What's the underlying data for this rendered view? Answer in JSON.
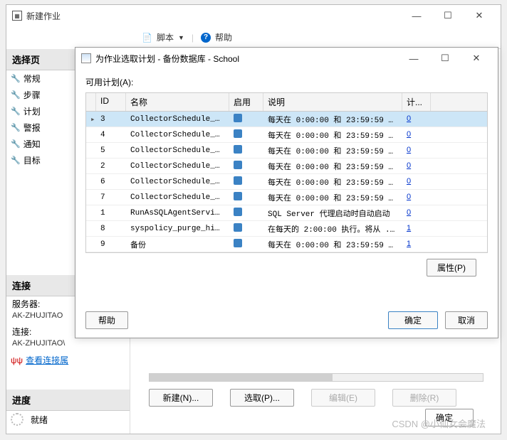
{
  "window": {
    "title": "新建作业",
    "min": "—",
    "max": "☐",
    "close": "✕"
  },
  "toolbar": {
    "script": "脚本",
    "dropdown": "▼",
    "help": "帮助"
  },
  "sidebar": {
    "select_header": "选择页",
    "items": [
      {
        "label": "常规"
      },
      {
        "label": "步骤"
      },
      {
        "label": "计划"
      },
      {
        "label": "警报"
      },
      {
        "label": "通知"
      },
      {
        "label": "目标"
      }
    ],
    "conn_header": "连接",
    "server_label": "服务器:",
    "server_val": "AK-ZHUJITAO",
    "conn_label": "连接:",
    "conn_val": "AK-ZHUJITAO\\",
    "view_conn": "查看连接属",
    "progress_header": "进度",
    "ready": "就绪"
  },
  "buttons": {
    "new": "新建(N)...",
    "pick": "选取(P)...",
    "edit": "编辑(E)",
    "delete": "删除(R)",
    "ok": "确定",
    "cancel": "取消",
    "help": "帮助",
    "props": "属性(P)"
  },
  "modal": {
    "title": "为作业选取计划 - 备份数据库 - School",
    "available": "可用计划(A):",
    "cols": {
      "id": "ID",
      "name": "名称",
      "enabled": "启用",
      "desc": "说明",
      "count": "计..."
    },
    "rows": [
      {
        "id": "3",
        "name": "CollectorSchedule_E...",
        "desc": "每天在 0:00:00 和 23:59:59 ...",
        "count": "0",
        "sel": true
      },
      {
        "id": "4",
        "name": "CollectorSchedule_E...",
        "desc": "每天在 0:00:00 和 23:59:59 ...",
        "count": "0"
      },
      {
        "id": "5",
        "name": "CollectorSchedule_E...",
        "desc": "每天在 0:00:00 和 23:59:59 ...",
        "count": "0"
      },
      {
        "id": "2",
        "name": "CollectorSchedule_E...",
        "desc": "每天在 0:00:00 和 23:59:59 ...",
        "count": "0"
      },
      {
        "id": "6",
        "name": "CollectorSchedule_E...",
        "desc": "每天在 0:00:00 和 23:59:59 ...",
        "count": "0"
      },
      {
        "id": "7",
        "name": "CollectorSchedule_E...",
        "desc": "每天在 0:00:00 和 23:59:59 ...",
        "count": "0"
      },
      {
        "id": "1",
        "name": "RunAsSQLAgentServic...",
        "desc": "SQL Server 代理启动时自动启动",
        "count": "0"
      },
      {
        "id": "8",
        "name": "syspolicy_purge_his...",
        "desc": "在每天的 2:00:00 执行。将从 ...",
        "count": "1"
      },
      {
        "id": "9",
        "name": "备份",
        "desc": "每天在 0:00:00 和 23:59:59 ...",
        "count": "1"
      }
    ]
  },
  "watermark": "CSDN @小仙女会魔法"
}
